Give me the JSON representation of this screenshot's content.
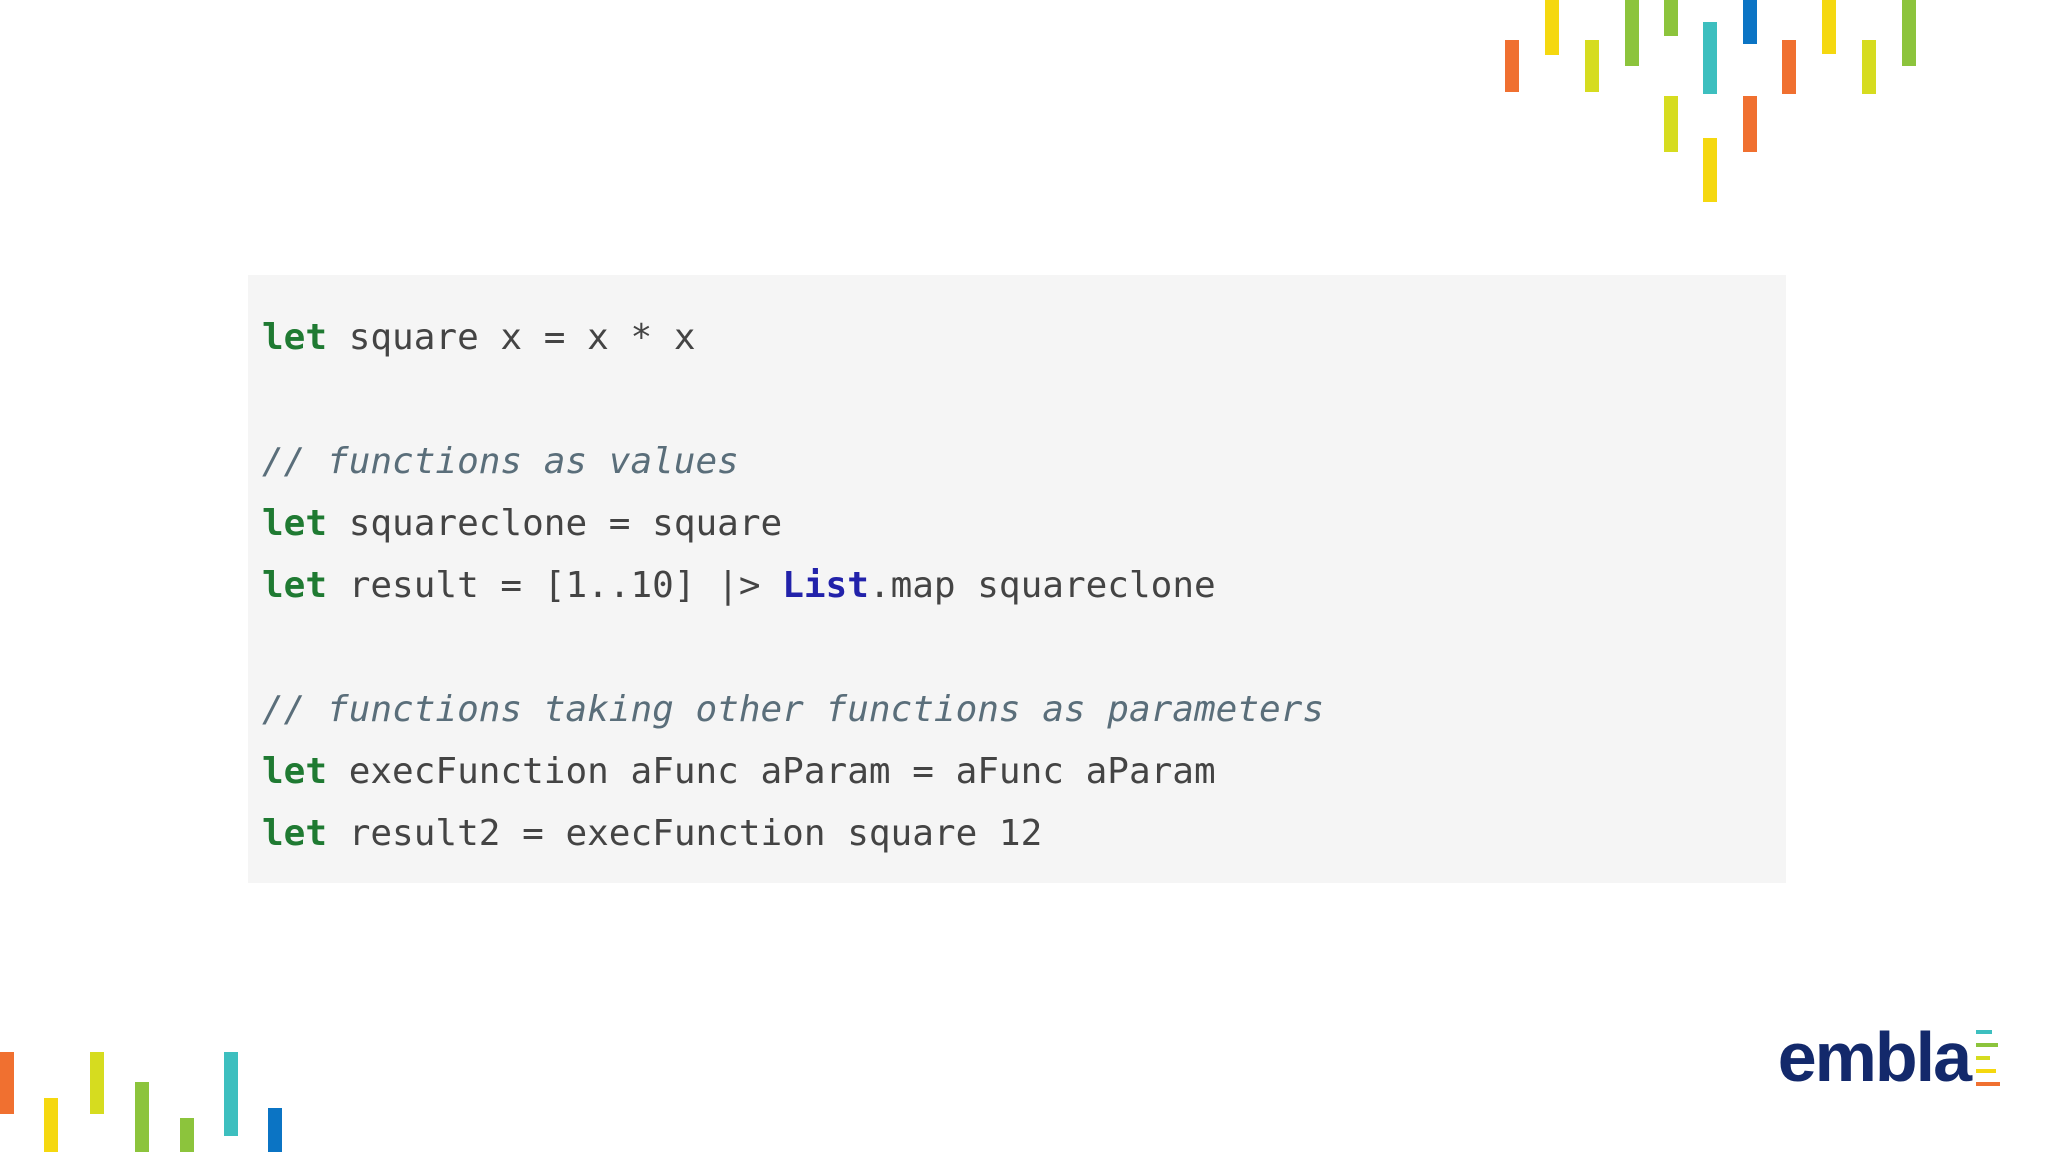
{
  "code": {
    "lines": [
      {
        "kw": "let",
        "text": " square x = x * x"
      },
      {
        "blank": ""
      },
      {
        "comment": "// functions as values"
      },
      {
        "kw": "let",
        "text": " squareclone = square"
      },
      {
        "kw": "let",
        "pre": " result = [1..10] |> ",
        "type": "List",
        "post": ".map squareclone"
      },
      {
        "blank": ""
      },
      {
        "comment": "// functions taking other functions as parameters"
      },
      {
        "kw": "let",
        "text": " execFunction aFunc aParam = aFunc aParam"
      },
      {
        "kw": "let",
        "text": " result2 = execFunction square 12"
      }
    ]
  },
  "brand": {
    "name": "embla"
  },
  "colors": {
    "keyword": "#1f7a32",
    "type": "#2222aa",
    "comment": "#5a6e7a",
    "code_bg": "#f5f5f5",
    "brand_navy": "#13296b",
    "stripe_orange": "#f07030",
    "stripe_yellow": "#f5d80f",
    "stripe_lime": "#d6dc1f",
    "stripe_green": "#8cc43c",
    "stripe_teal": "#3dbfbf",
    "stripe_blue": "#0b74c4"
  }
}
